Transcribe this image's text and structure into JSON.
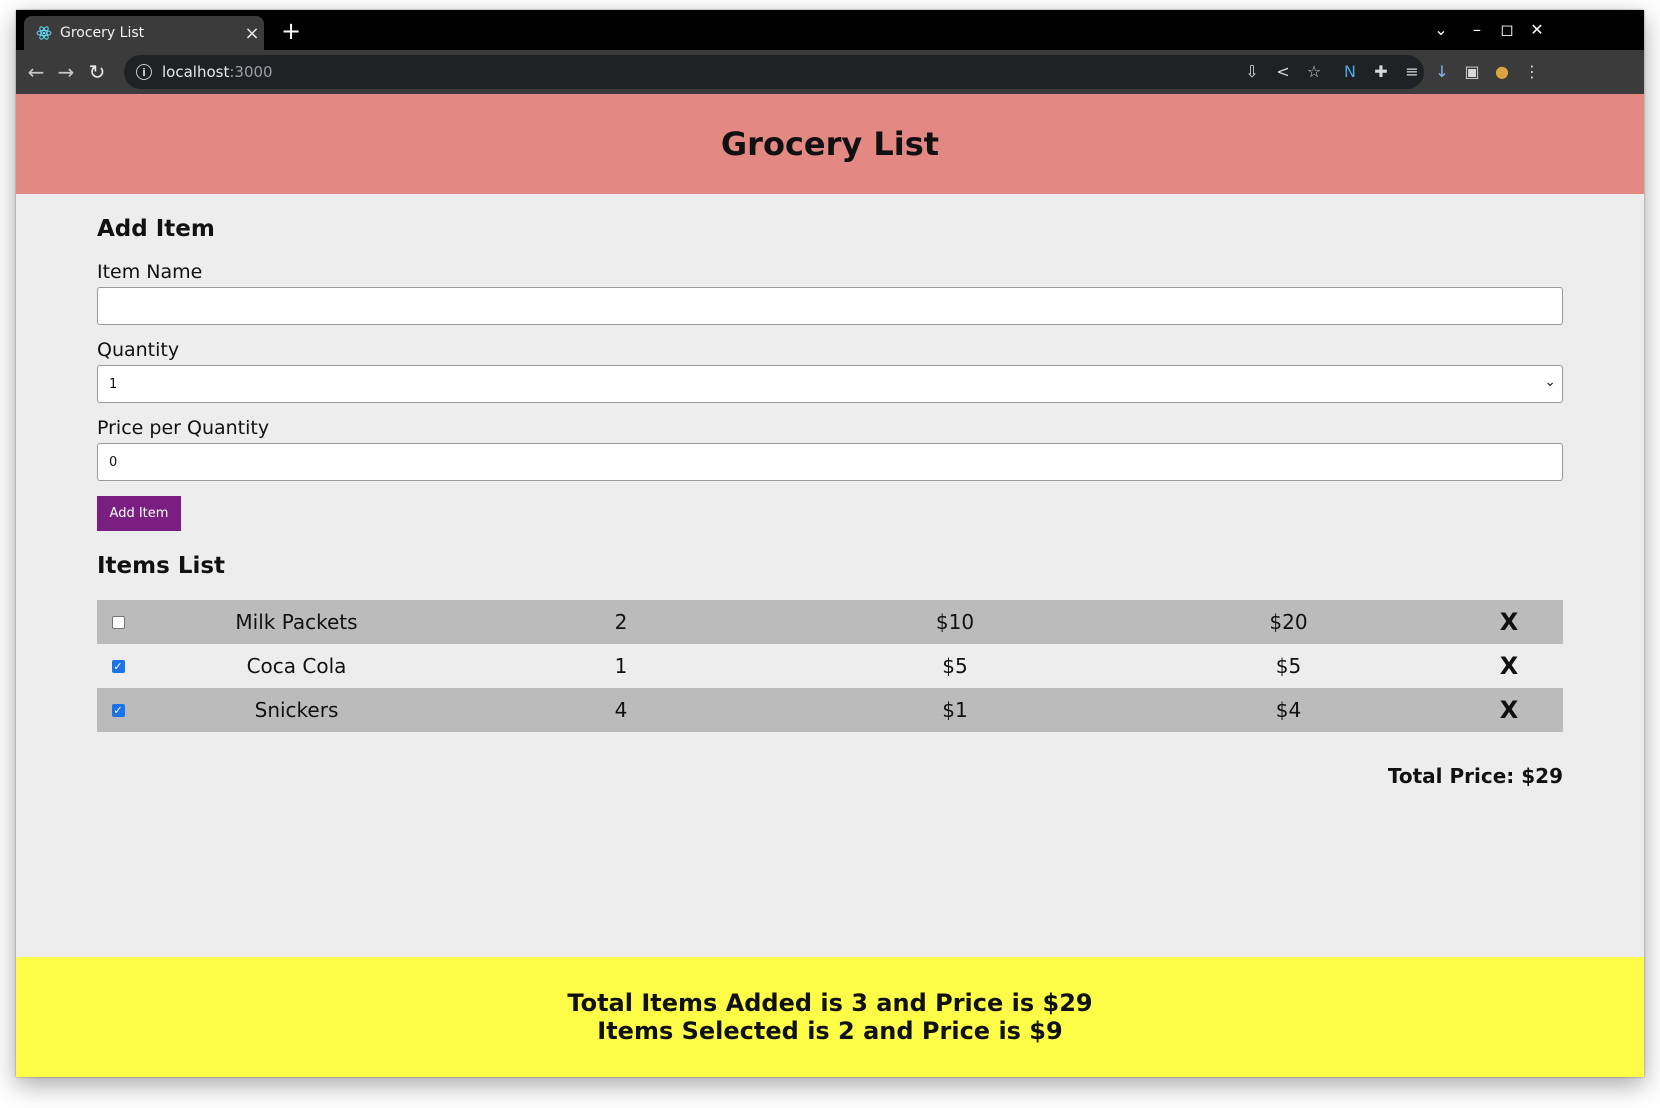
{
  "browser": {
    "tab_title": "Grocery List",
    "tab_close": "×",
    "new_tab": "+",
    "url_host": "localhost",
    "url_port": ":3000"
  },
  "page": {
    "title": "Grocery List",
    "add_section_title": "Add Item",
    "item_name_label": "Item Name",
    "item_name_value": "",
    "quantity_label": "Quantity",
    "quantity_value": "1",
    "price_label": "Price per Quantity",
    "price_value": "0",
    "add_button": "Add Item",
    "list_section_title": "Items List",
    "items": [
      {
        "checked": false,
        "name": "Milk Packets",
        "qty": "2",
        "price": "$10",
        "total": "$20",
        "delete": "X"
      },
      {
        "checked": true,
        "name": "Coca Cola",
        "qty": "1",
        "price": "$5",
        "total": "$5",
        "delete": "X"
      },
      {
        "checked": true,
        "name": "Snickers",
        "qty": "4",
        "price": "$1",
        "total": "$4",
        "delete": "X"
      }
    ],
    "total_price": "Total Price: $29",
    "footer_line1": "Total Items Added is 3 and Price is $29",
    "footer_line2": "Items Selected is 2 and Price is $9"
  },
  "colors": {
    "header_bg": "#e38883",
    "footer_bg": "#fdfc47",
    "button_bg": "#7a1e82",
    "row_shaded": "#bbbbbb"
  }
}
